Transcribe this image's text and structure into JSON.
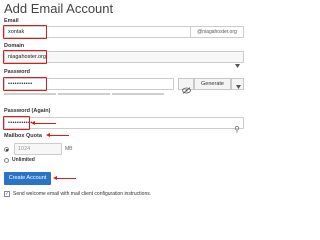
{
  "page": {
    "title": "Add Email Account"
  },
  "email": {
    "label": "Email",
    "value": "xontak",
    "domain_suffix": "@niagahoster.org"
  },
  "domain": {
    "label": "Domain",
    "selected": "niagahoster.org"
  },
  "password": {
    "label": "Password",
    "value": "•••••••••••",
    "generate_label": "Generate",
    "strength_level": 0
  },
  "password_again": {
    "label": "Password (Again)",
    "value": "•••••••••••"
  },
  "quota": {
    "label": "Mailbox Quota",
    "value": "1024",
    "unit": "MB",
    "unlimited_label": "Unlimited",
    "selected": "limited"
  },
  "actions": {
    "create_label": "Create Account"
  },
  "welcome": {
    "label": "Send welcome email with mail client configuration instructions.",
    "checked": true
  },
  "annotation_color": "#e01a1a",
  "accent_color": "#2a73c6",
  "icons": {
    "eye": "eye-slash-icon",
    "caret": "chevron-down-icon",
    "key": "key-icon",
    "arrow": "arrow-left-icon"
  }
}
